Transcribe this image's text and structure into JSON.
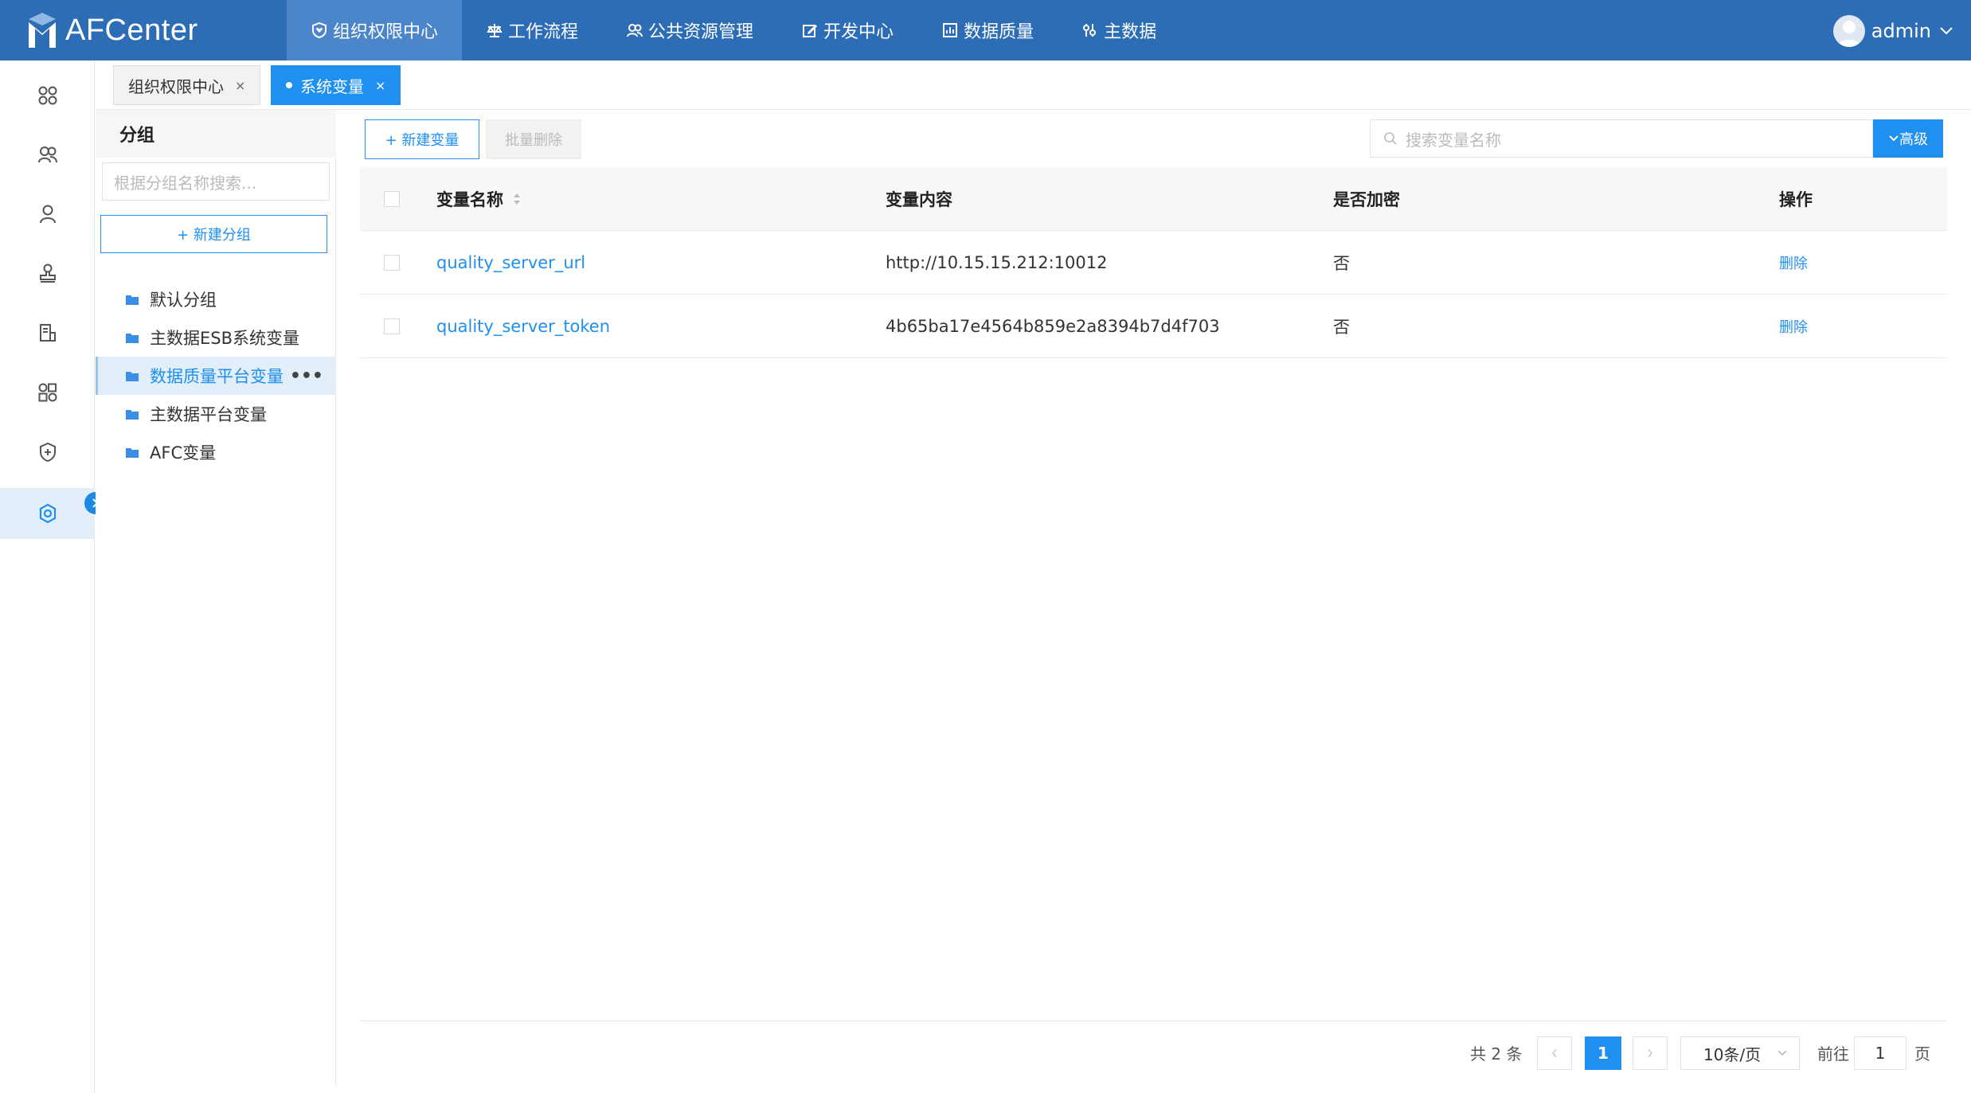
{
  "app": {
    "name": "AFCenter"
  },
  "nav": [
    {
      "label": "组织权限中心",
      "icon": "shield-heart-icon"
    },
    {
      "label": "工作流程",
      "icon": "scale-icon"
    },
    {
      "label": "公共资源管理",
      "icon": "users-icon"
    },
    {
      "label": "开发中心",
      "icon": "edit-icon"
    },
    {
      "label": "数据质量",
      "icon": "chart-icon"
    },
    {
      "label": "主数据",
      "icon": "settings-tools-icon"
    }
  ],
  "user": {
    "name": "admin"
  },
  "tabs": [
    {
      "label": "组织权限中心",
      "close": "×"
    },
    {
      "label": "系统变量",
      "close": "×"
    }
  ],
  "group_panel": {
    "title": "分组",
    "search_placeholder": "根据分组名称搜索...",
    "new_button": "+ 新建分组",
    "items": [
      {
        "label": "默认分组"
      },
      {
        "label": "主数据ESB系统变量"
      },
      {
        "label": "数据质量平台变量"
      },
      {
        "label": "主数据平台变量"
      },
      {
        "label": "AFC变量"
      }
    ],
    "more_label": "•••"
  },
  "toolbar": {
    "new_button": "+ 新建变量",
    "batch_delete": "批量删除",
    "search_placeholder": "搜索变量名称",
    "advanced": "高级"
  },
  "table": {
    "columns": [
      "变量名称",
      "变量内容",
      "是否加密",
      "操作"
    ],
    "rows": [
      {
        "name": "quality_server_url",
        "content": "http://10.15.15.212:10012",
        "encrypted": "否",
        "action": "删除"
      },
      {
        "name": "quality_server_token",
        "content": "4b65ba17e4564b859e2a8394b7d4f703",
        "encrypted": "否",
        "action": "删除"
      }
    ]
  },
  "pagination": {
    "total_text": "共 2 条",
    "current_page": "1",
    "page_size": "10条/页",
    "goto_label": "前往",
    "goto_value": "1",
    "page_suffix": "页"
  },
  "colors": {
    "header": "#2d6db5",
    "accent": "#1f8ff0",
    "active_bg": "#e3eefb"
  }
}
